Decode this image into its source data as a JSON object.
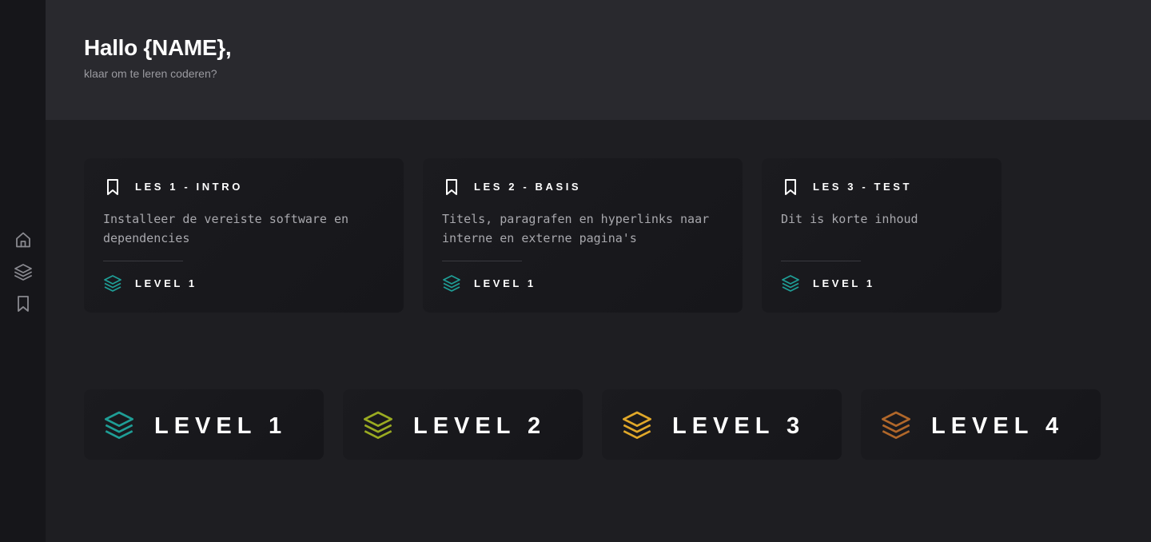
{
  "sidebar": {
    "items": [
      {
        "icon": "home-icon"
      },
      {
        "icon": "layers-icon"
      },
      {
        "icon": "bookmark-icon"
      }
    ]
  },
  "header": {
    "greeting": "Hallo {NAME},",
    "subtitle": "klaar om te leren coderen?"
  },
  "lessons": [
    {
      "title": "LES 1 - INTRO",
      "description": "Installeer de vereiste software en dependencies",
      "level_label": "LEVEL 1",
      "level_color": "#1f9e96"
    },
    {
      "title": "LES 2 - BASIS",
      "description": "Titels, paragrafen en hyperlinks naar interne en externe pagina's",
      "level_label": "LEVEL 1",
      "level_color": "#1f9e96"
    },
    {
      "title": "LES 3 - TEST",
      "description": "Dit is korte inhoud",
      "level_label": "LEVEL 1",
      "level_color": "#1f9e96"
    }
  ],
  "levels": [
    {
      "label": "LEVEL 1",
      "color": "#1f9e96"
    },
    {
      "label": "LEVEL 2",
      "color": "#9aab22"
    },
    {
      "label": "LEVEL 3",
      "color": "#e0a82a"
    },
    {
      "label": "LEVEL 4",
      "color": "#b0672a"
    }
  ],
  "colors": {
    "sidebar_bg": "#16161a",
    "header_bg": "#29292e",
    "main_bg": "#1e1e22",
    "card_bg": "#18181c",
    "icon_gray": "#8a8a90"
  }
}
